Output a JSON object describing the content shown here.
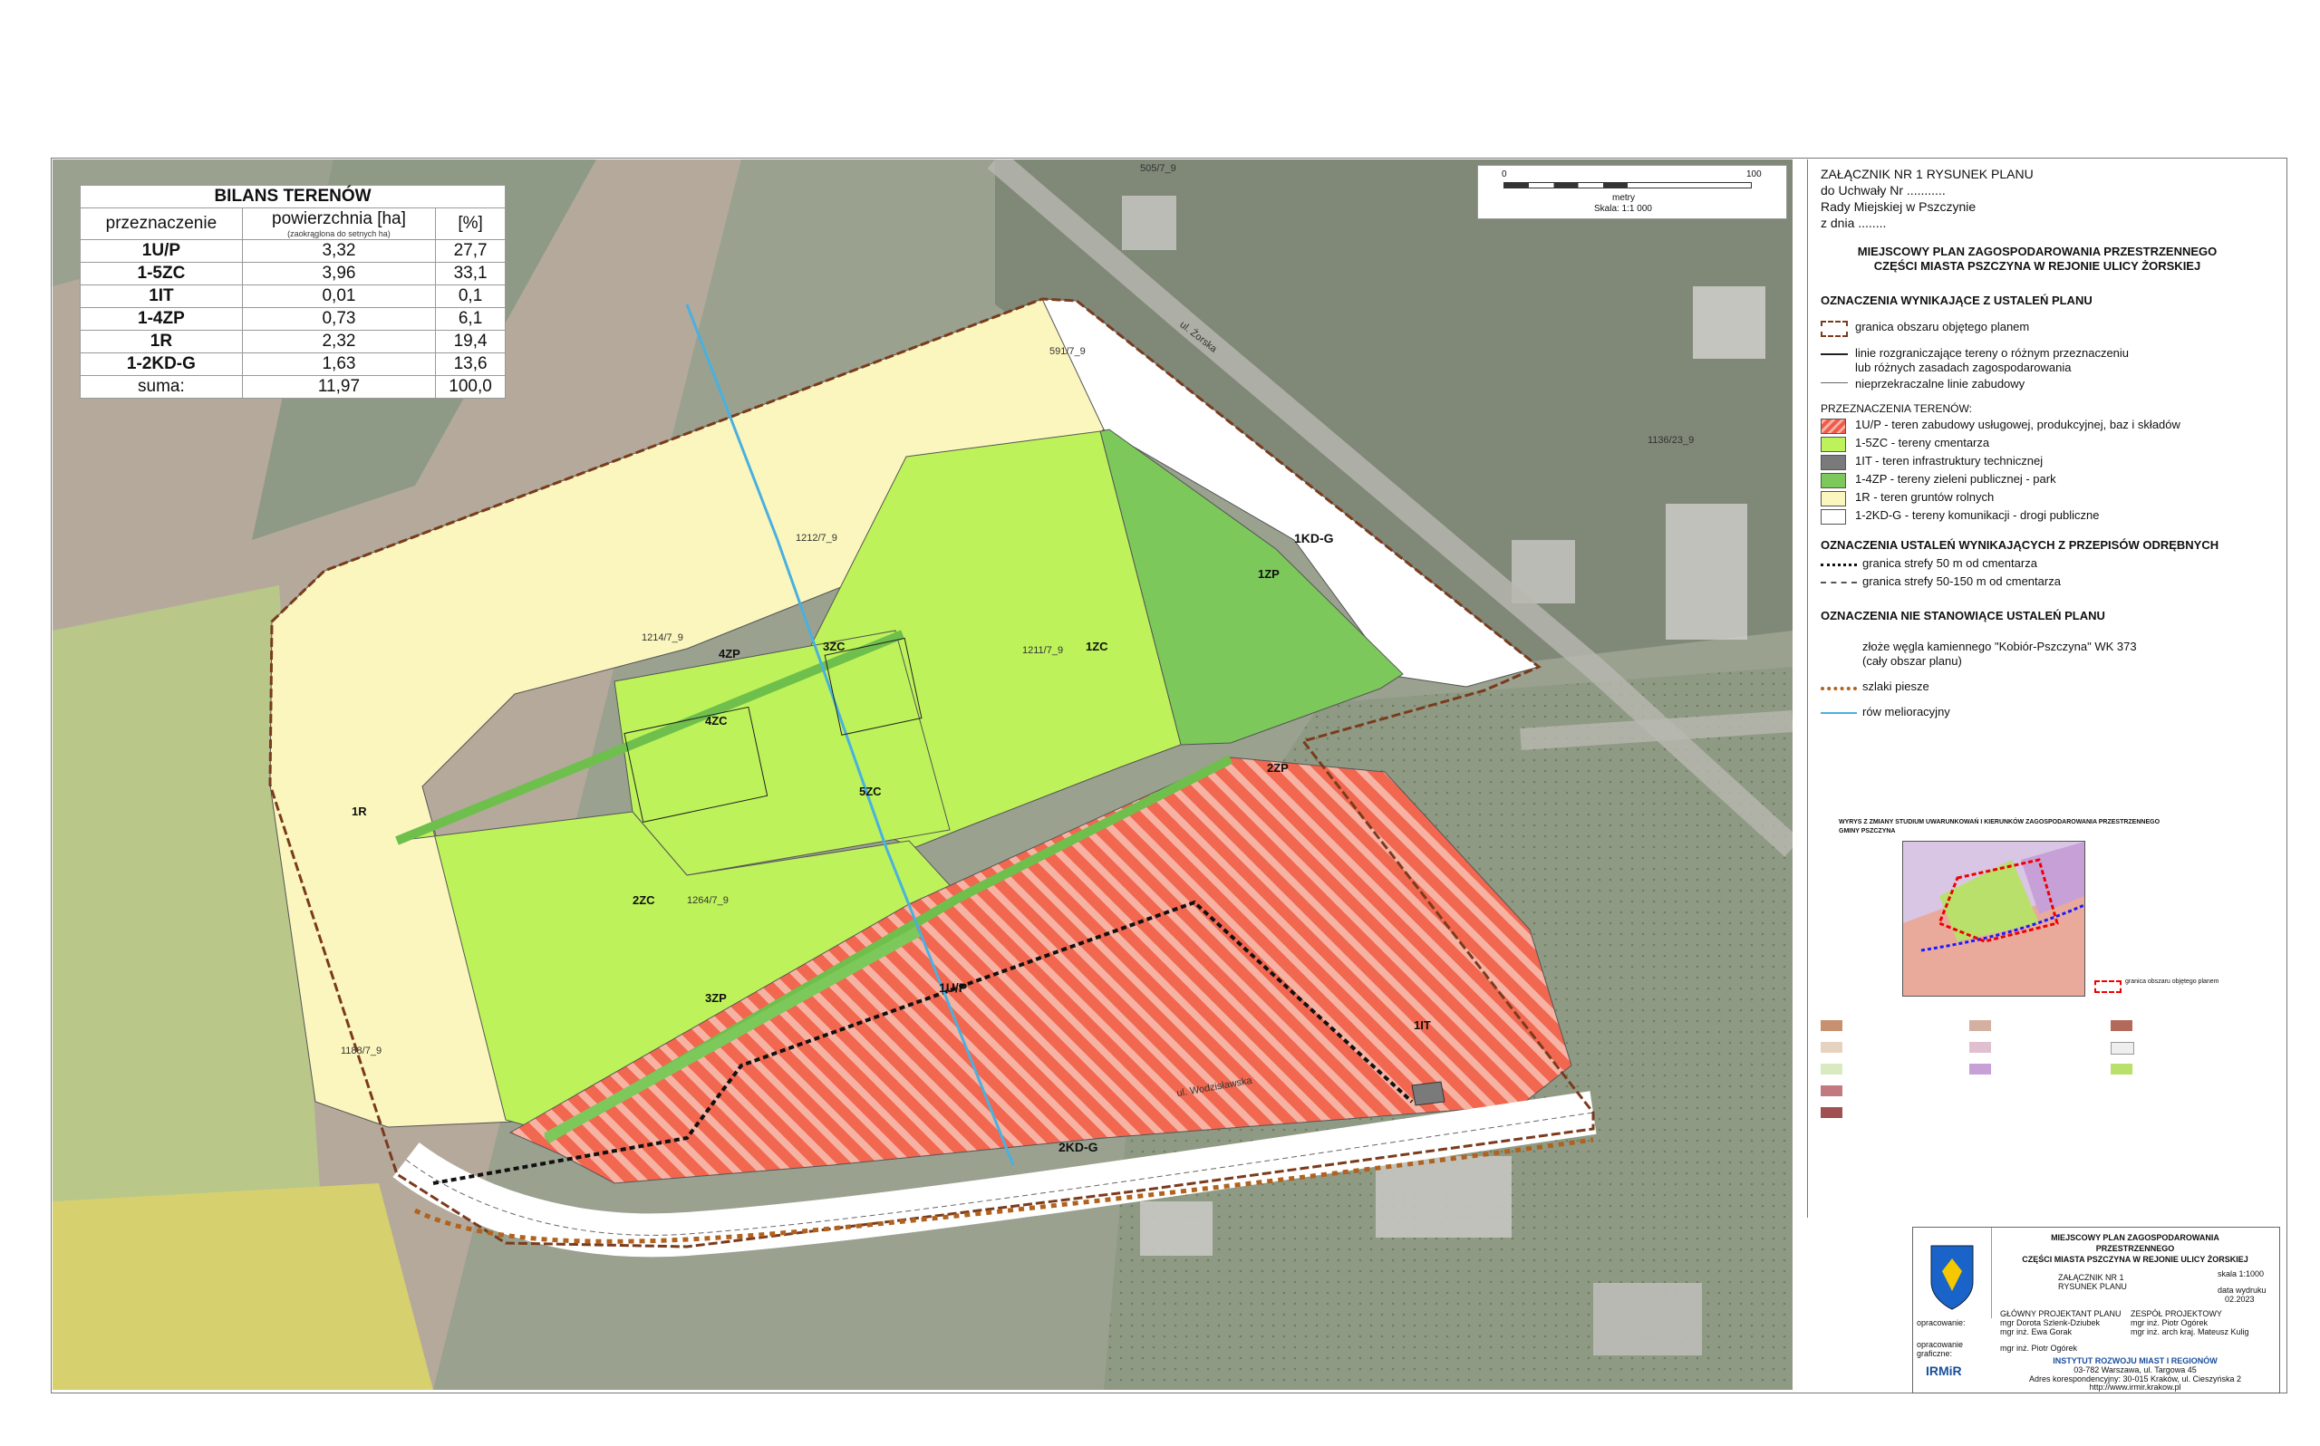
{
  "bilans": {
    "title": "BILANS TERENÓW",
    "headers": [
      "przeznaczenie",
      "powierzchnia [ha]",
      "(zaokrąglona do setnych ha)",
      "[%]"
    ],
    "rows": [
      [
        "1U/P",
        "3,32",
        "27,7"
      ],
      [
        "1-5ZC",
        "3,96",
        "33,1"
      ],
      [
        "1IT",
        "0,01",
        "0,1"
      ],
      [
        "1-4ZP",
        "0,73",
        "6,1"
      ],
      [
        "1R",
        "2,32",
        "19,4"
      ],
      [
        "1-2KD-G",
        "1,63",
        "13,6"
      ],
      [
        "suma:",
        "11,97",
        "100,0"
      ]
    ]
  },
  "scale": {
    "start": "0",
    "end": "100",
    "unit": "metry",
    "ratio": "Skala: 1:1 000"
  },
  "map_labels": {
    "r1": "1R",
    "zc1": "1ZC",
    "zc2": "2ZC",
    "zc3": "3ZC",
    "zc4": "4ZC",
    "zc5": "5ZC",
    "zp1": "1ZP",
    "zp2": "2ZP",
    "zp3": "3ZP",
    "zp4": "4ZP",
    "up1": "1U/P",
    "it1": "1IT",
    "kd1": "1KD-G",
    "kd2": "2KD-G",
    "street1": "ul. Żorska",
    "street2": "ul. Wodzisławska"
  },
  "parcels": [
    "1212/7_9",
    "1214/7_9",
    "1211/7_9",
    "1264/7_9",
    "1188/7_9",
    "1136/23_9",
    "591/7_9",
    "505/7_9"
  ],
  "header": {
    "l1": "ZAŁĄCZNIK NR 1  RYSUNEK PLANU",
    "l2": "do Uchwały Nr ...........",
    "l3": "Rady Miejskiej w Pszczynie",
    "l4": "z dnia ........",
    "title1": "MIEJSCOWY PLAN ZAGOSPODAROWANIA PRZESTRZENNEGO",
    "title2": "CZĘŚCI MIASTA PSZCZYNA W REJONIE ULICY ŻORSKIEJ"
  },
  "legend": {
    "sec1": "OZNACZENIA WYNIKAJĄCE Z USTALEŃ PLANU",
    "granica": "granica obszaru objętego planem",
    "linie1": "linie rozgraniczające tereny o różnym przeznaczeniu",
    "linie2": "lub różnych zasadach zagospodarowania",
    "nieprz": "nieprzekraczalne linie zabudowy",
    "przezn": "PRZEZNACZENIA TERENÓW:",
    "items": [
      {
        "text": "1U/P - teren zabudowy usługowej, produkcyjnej, baz i składów",
        "color": "#f05a4a"
      },
      {
        "text": "1-5ZC - tereny cmentarza",
        "color": "#bdf25a"
      },
      {
        "text": "1IT - teren infrastruktury technicznej",
        "color": "#7a7a7a"
      },
      {
        "text": "1-4ZP - tereny zieleni publicznej - park",
        "color": "#7cc85a"
      },
      {
        "text": "1R - teren gruntów rolnych",
        "color": "#fbf6be"
      },
      {
        "text": "1-2KD-G - tereny komunikacji - drogi publiczne",
        "color": "#ffffff"
      }
    ],
    "sec2": "OZNACZENIA USTALEŃ WYNIKAJĄCYCH Z PRZEPISÓW ODRĘBNYCH",
    "strefa50": "granica strefy 50 m od cmentarza",
    "strefa150": "granica strefy 50-150  m od cmentarza",
    "sec3": "OZNACZENIA NIE STANOWIĄCE USTALEŃ PLANU",
    "zloze1": "złoże węgla kamiennego \"Kobiór-Pszczyna\" WK 373",
    "zloze2": "(cały obszar planu)",
    "szlaki": "szlaki piesze",
    "row": "rów melioracyjny",
    "wyrys1": "WYRYS Z ZMIANY STUDIUM UWARUNKOWAŃ I KIERUNKÓW ZAGOSPODAROWANIA PRZESTRZENNEGO",
    "wyrys2": "GMINY PSZCZYNA",
    "inset_legend": "granica obszaru objętego planem"
  },
  "titleblock": {
    "t1": "MIEJSCOWY PLAN ZAGOSPODAROWANIA",
    "t2": "PRZESTRZENNEGO",
    "t3": "CZĘŚCI MIASTA PSZCZYNA W REJONIE ULICY ŻORSKIEJ",
    "zal1": "ZAŁĄCZNIK NR 1",
    "zal2": "RYSUNEK PLANU",
    "skala": "skala 1:1000",
    "data_lbl": "data wydruku",
    "data": "02.2023",
    "opr": "opracowanie:",
    "gl": "GŁÓWNY PROJEKTANT PLANU",
    "gl1": "mgr Dorota Szlenk-Dziubek",
    "gl2": "mgr inż. Ewa Gorak",
    "zesp": "ZESPÓŁ PROJEKTOWY",
    "z1": "mgr inż. Piotr Ogórek",
    "z2": "mgr inż. arch kraj. Mateusz Kulig",
    "graf": "opracowanie graficzne:",
    "graf1": "mgr inż. Piotr Ogórek",
    "logo": "IRMiR",
    "inst": "INSTYTUT ROZWOJU MIAST I REGIONÓW",
    "adr1": "03-782 Warszawa, ul. Targowa 45",
    "adr2": "Adres korespondencyjny: 30-015 Kraków, ul. Cieszyńska 2",
    "www": "http://www.irmir.krakow.pl"
  }
}
